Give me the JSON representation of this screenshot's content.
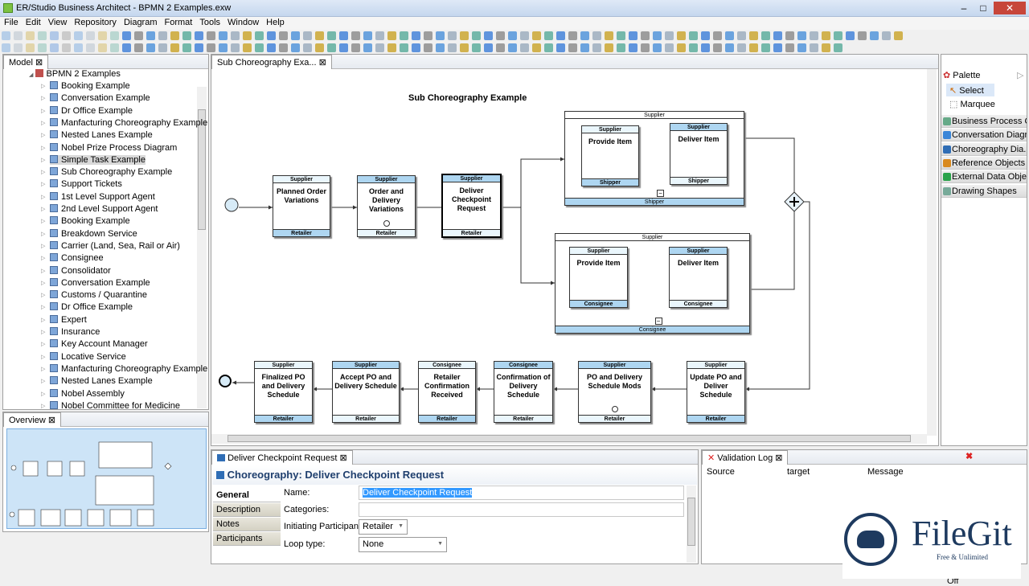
{
  "window": {
    "title": "ER/Studio Business Architect - BPMN 2 Examples.exw"
  },
  "menu": [
    "File",
    "Edit",
    "View",
    "Repository",
    "Diagram",
    "Format",
    "Tools",
    "Window",
    "Help"
  ],
  "model_panel": {
    "tab": "Model",
    "root": "BPMN 2 Examples",
    "selected": "Simple Task Example",
    "items": [
      "Booking Example",
      "Conversation Example",
      "Dr Office Example",
      "Manfacturing Choreography Example",
      "Nested Lanes Example",
      "Nobel Prize Process Diagram",
      "Simple Task Example",
      "Sub Choreography Example",
      "Support Tickets",
      "1st Level Support Agent",
      "2nd Level Support Agent",
      "Booking Example",
      "Breakdown Service",
      "Carrier (Land, Sea, Rail or Air)",
      "Consignee",
      "Consolidator",
      "Conversation Example",
      "Customs / Quarantine",
      "Dr Office Example",
      "Expert",
      "Insurance",
      "Key Account Manager",
      "Locative Service",
      "Manfacturing Choreography Example",
      "Nested Lanes Example",
      "Nobel Assembly",
      "Nobel Committee for Medicine"
    ]
  },
  "overview_panel": {
    "tab": "Overview"
  },
  "editor": {
    "tab": "Sub Choreography Exa...",
    "diagram_title": "Sub Choreography Example",
    "tasks": {
      "t1": {
        "name": "Planned Order Variations",
        "top": "Supplier",
        "bottom": "Retailer"
      },
      "t2": {
        "name": "Order and Delivery Variations",
        "top": "Supplier",
        "bottom": "Retailer"
      },
      "t3": {
        "name": "Deliver Checkpoint Request",
        "top": "Supplier",
        "bottom": "Retailer"
      },
      "s1": {
        "top": "Supplier",
        "bottom": "Shipper"
      },
      "s1a": {
        "name": "Provide Item",
        "top": "Supplier",
        "bottom": "Shipper"
      },
      "s1b": {
        "name": "Deliver Item",
        "top": "Supplier",
        "bottom": "Shipper"
      },
      "s2": {
        "top": "Supplier",
        "bottom": "Consignee"
      },
      "s2a": {
        "name": "Provide Item",
        "top": "Supplier",
        "bottom": "Consignee"
      },
      "s2b": {
        "name": "Deliver Item",
        "top": "Supplier",
        "bottom": "Consignee"
      },
      "b1": {
        "name": "Update PO and Deliver Schedule",
        "top": "Supplier",
        "bottom": "Retailer"
      },
      "b2": {
        "name": "PO and Delivery Schedule Mods",
        "top": "Supplier",
        "bottom": "Retailer"
      },
      "b3": {
        "name": "Confirmation of Delivery Schedule",
        "top": "Consignee",
        "bottom": "Retailer"
      },
      "b4": {
        "name": "Retailer Confirmation Received",
        "top": "Consignee",
        "bottom": "Retailer"
      },
      "b5": {
        "name": "Accept PO and Delivery Schedule",
        "top": "Supplier",
        "bottom": "Retailer"
      },
      "b6": {
        "name": "Finalized PO and Delivery Schedule",
        "top": "Supplier",
        "bottom": "Retailer"
      }
    }
  },
  "palette": {
    "title": "Palette",
    "tools": [
      "Select",
      "Marquee"
    ],
    "drawers": [
      "Business Process O...",
      "Conversation Diagr...",
      "Choreography  Dia...",
      "Reference Objects",
      "External Data Obje...",
      "Drawing Shapes"
    ]
  },
  "properties": {
    "tab": "Deliver Checkpoint Request",
    "header": "Choreography: Deliver Checkpoint Request",
    "tabs": [
      "General",
      "Description",
      "Notes",
      "Participants"
    ],
    "name_label": "Name:",
    "name_value": "Deliver Checkpoint Request",
    "categories_label": "Categories:",
    "categories_value": "",
    "initiating_label": "Initiating Participant",
    "initiating_value": "Retailer",
    "loop_label": "Loop type:",
    "loop_value": "None"
  },
  "validation": {
    "tab": "Validation Log",
    "columns": [
      "Source",
      "target",
      "Message"
    ]
  },
  "status": {
    "text": "Model View Filter: Off"
  },
  "watermark": {
    "brand": "FileGit",
    "tagline": "Free & Unlimited"
  }
}
